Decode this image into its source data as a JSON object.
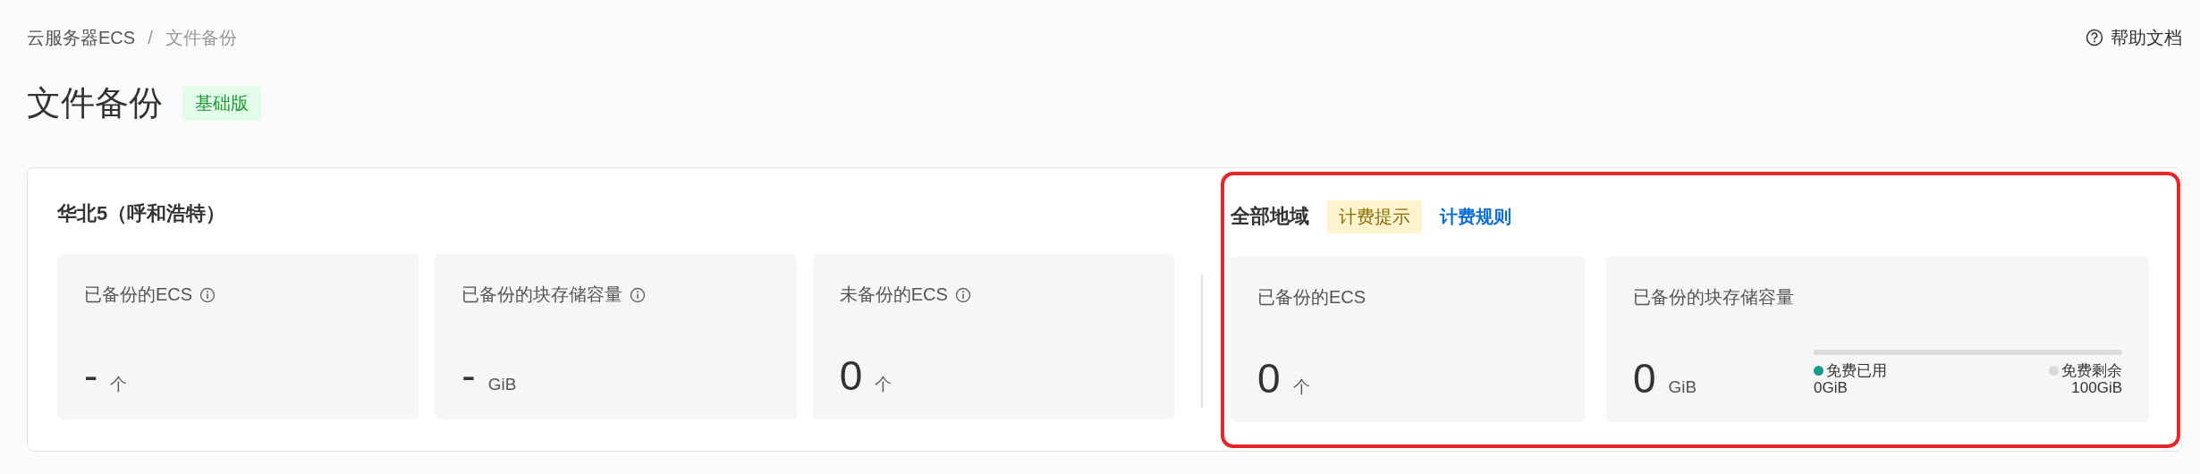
{
  "breadcrumb": {
    "items": [
      {
        "label": "云服务器ECS"
      },
      {
        "label": "文件备份"
      }
    ],
    "separator": "/"
  },
  "help_link": {
    "label": "帮助文档"
  },
  "page": {
    "title": "文件备份",
    "edition_badge": "基础版"
  },
  "region_section": {
    "title": "华北5（呼和浩特）",
    "stats": [
      {
        "label": "已备份的ECS",
        "info": true,
        "value": "-",
        "unit": "个"
      },
      {
        "label": "已备份的块存储容量",
        "info": true,
        "value": "-",
        "unit": "GiB"
      },
      {
        "label": "未备份的ECS",
        "info": true,
        "value": "0",
        "unit": "个"
      }
    ]
  },
  "all_regions_section": {
    "title": "全部地域",
    "highlighted": true,
    "billing_tip": "计费提示",
    "billing_rules_link": "计费规则",
    "stats": [
      {
        "kind": "plain",
        "label": "已备份的ECS",
        "info": false,
        "value": "0",
        "unit": "个"
      },
      {
        "kind": "quota",
        "label": "已备份的块存储容量",
        "info": false,
        "value": "0",
        "unit": "GiB",
        "usage": {
          "level": 0,
          "legend": [
            {
              "label": "免费已用",
              "value": "0GiB",
              "color": "#1a9b8f"
            },
            {
              "label": "免费剩余",
              "value": "100GiB",
              "color": "#d9d9d9"
            }
          ]
        }
      }
    ]
  }
}
